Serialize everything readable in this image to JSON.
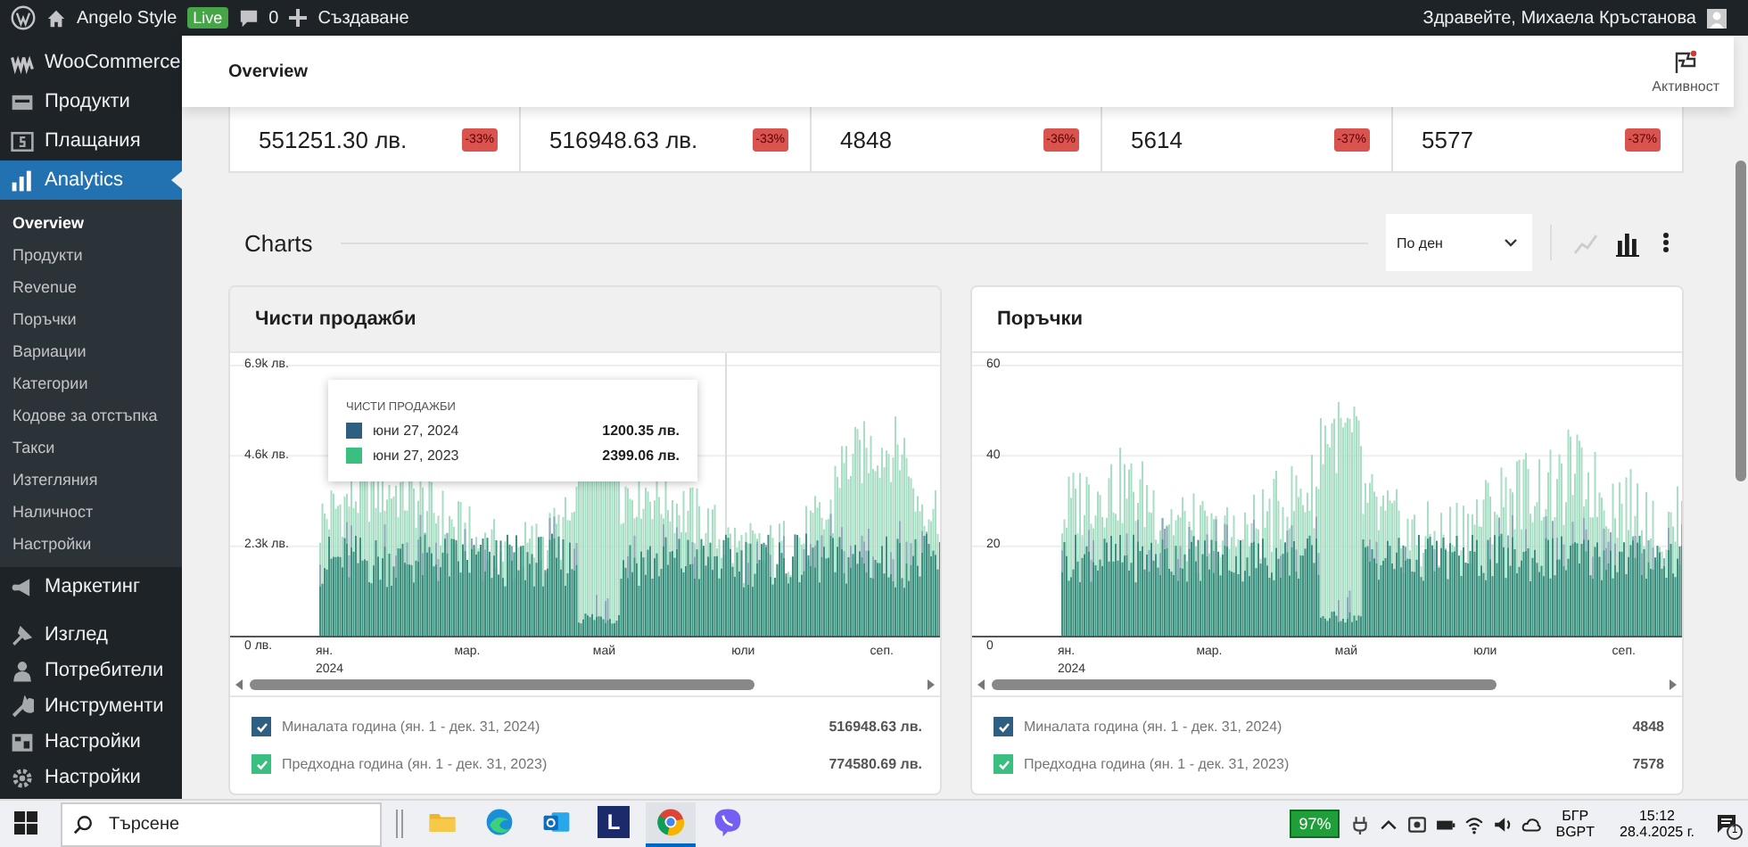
{
  "admin_bar": {
    "site": "Angelo Style",
    "badge": "Live",
    "comments": "0",
    "new": "Създаване",
    "greeting": "Здравейте, Михаела Кръстанова"
  },
  "sidebar": {
    "items": [
      {
        "label": "WooCommerce",
        "selected": false
      },
      {
        "label": "Продукти",
        "selected": false
      },
      {
        "label": "Плащания",
        "selected": false
      },
      {
        "label": "Analytics",
        "selected": true,
        "children": [
          {
            "label": "Overview",
            "selected": true
          },
          {
            "label": "Продукти",
            "selected": false
          },
          {
            "label": "Revenue",
            "selected": false
          },
          {
            "label": "Поръчки",
            "selected": false
          },
          {
            "label": "Вариации",
            "selected": false
          },
          {
            "label": "Категории",
            "selected": false
          },
          {
            "label": "Кодове за отстъпка",
            "selected": false
          },
          {
            "label": "Такси",
            "selected": false
          },
          {
            "label": "Изтегляния",
            "selected": false
          },
          {
            "label": "Наличност",
            "selected": false
          },
          {
            "label": "Настройки",
            "selected": false
          }
        ]
      },
      {
        "label": "Маркетинг",
        "selected": false
      },
      {
        "label": "Изглед",
        "selected": false
      },
      {
        "label": "Потребители",
        "selected": false
      },
      {
        "label": "Инструменти",
        "selected": false
      },
      {
        "label": "Настройки",
        "selected": false
      },
      {
        "label": "Настройки",
        "selected": false
      }
    ]
  },
  "header": {
    "title": "Overview",
    "activity": "Активност"
  },
  "stats": [
    {
      "value": "551251.30 лв.",
      "delta": "-33%"
    },
    {
      "value": "516948.63 лв.",
      "delta": "-33%"
    },
    {
      "value": "4848",
      "delta": "-36%"
    },
    {
      "value": "5614",
      "delta": "-37%"
    },
    {
      "value": "5577",
      "delta": "-37%"
    }
  ],
  "charts_section": {
    "title": "Charts",
    "interval": "По ден",
    "chart_types": [
      {
        "kind": "line",
        "selected": false
      },
      {
        "kind": "bar",
        "selected": true
      }
    ]
  },
  "charts": [
    {
      "title": "Чисти продажби",
      "highlighted": true,
      "y_ticks": [
        "6.9k лв.",
        "4.6k лв.",
        "2.3k лв.",
        "0 лв."
      ],
      "x_labels": [
        {
          "label": "ян.",
          "year": "2024"
        },
        {
          "label": "мар."
        },
        {
          "label": "май"
        },
        {
          "label": "юли"
        },
        {
          "label": "сеп."
        }
      ],
      "tooltip": {
        "title": "ЧИСТИ ПРОДАЖБИ",
        "rows": [
          {
            "date": "юни 27, 2024",
            "value": "1200.35 лв.",
            "color": "#2f5f80"
          },
          {
            "date": "юни 27, 2023",
            "value": "2399.06 лв.",
            "color": "#3bbf80"
          }
        ]
      },
      "legend": [
        {
          "label": "Миналата година (ян. 1 - дек. 31, 2024)",
          "value": "516948.63 лв.",
          "checked": true,
          "color": "#2f5f80"
        },
        {
          "label": "Предходна година (ян. 1 - дек. 31, 2023)",
          "value": "774580.69 лв.",
          "checked": true,
          "color": "#3bbf80"
        }
      ]
    },
    {
      "title": "Поръчки",
      "highlighted": false,
      "y_ticks": [
        "60",
        "40",
        "20",
        "0"
      ],
      "x_labels": [
        {
          "label": "ян.",
          "year": "2024"
        },
        {
          "label": "мар."
        },
        {
          "label": "май"
        },
        {
          "label": "юли"
        },
        {
          "label": "сеп."
        }
      ],
      "legend": [
        {
          "label": "Миналата година (ян. 1 - дек. 31, 2024)",
          "value": "4848",
          "checked": true,
          "color": "#2f5f80"
        },
        {
          "label": "Предходна година (ян. 1 - дек. 31, 2023)",
          "value": "7578",
          "checked": true,
          "color": "#3bbf80"
        }
      ]
    }
  ],
  "taskbar": {
    "search": {
      "placeholder": "Търсене"
    },
    "apps": [
      {
        "kind": "folder",
        "selected": false
      },
      {
        "kind": "edge",
        "selected": false
      },
      {
        "kind": "outlook",
        "selected": false
      },
      {
        "kind": "letter",
        "label": "L",
        "selected": false
      },
      {
        "kind": "chrome",
        "selected": true
      },
      {
        "kind": "viber",
        "selected": false
      }
    ],
    "battery": "97%",
    "language": "БГР",
    "layout": "BGPT",
    "time": "15:12",
    "date": "28.4.2025 г.",
    "notifications": "1"
  }
}
